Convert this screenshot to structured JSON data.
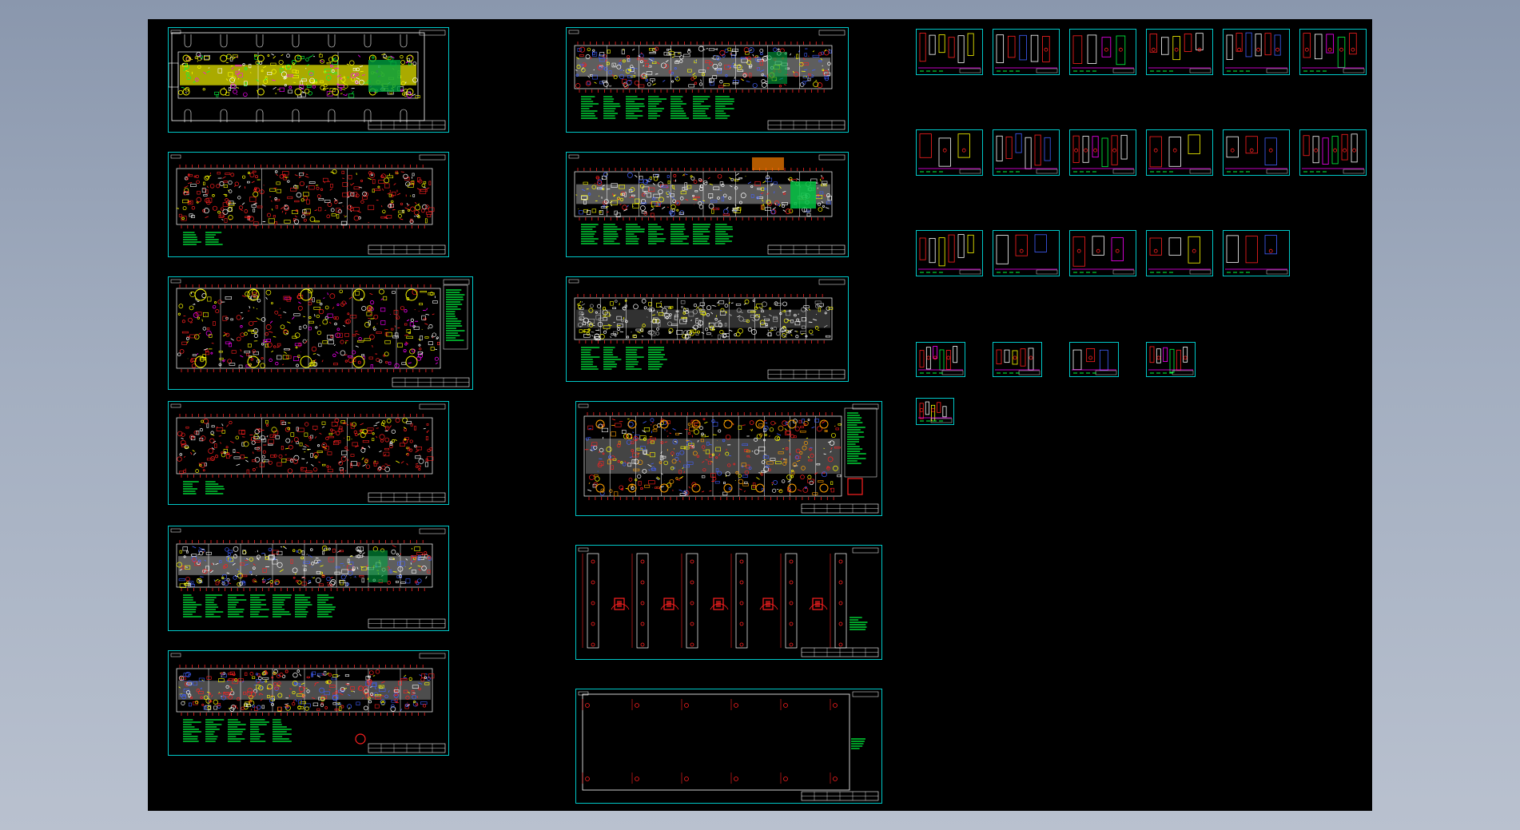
{
  "viewer": {
    "background_top": "#8a97ad",
    "background_bottom": "#b9c1cf",
    "canvas_color": "#000000"
  },
  "colors": {
    "frame": "#00c8c8",
    "red": "#ff2020",
    "yellow": "#ffff00",
    "green": "#00ff40",
    "white": "#ffffff",
    "gray": "#b0b0b0",
    "magenta": "#ff00ff",
    "orange": "#ffa000",
    "blue": "#4060ff"
  },
  "drawing_sheets": {
    "left_column": [
      {
        "id": "L1",
        "style": "yellow-green-layout"
      },
      {
        "id": "L2",
        "style": "red-plate"
      },
      {
        "id": "L3",
        "style": "red-plate-circles-notes"
      },
      {
        "id": "L4",
        "style": "red-plate"
      },
      {
        "id": "L5",
        "style": "gray-strip-notes"
      },
      {
        "id": "L6",
        "style": "red-gray-strip-notes"
      }
    ],
    "middle_column": [
      {
        "id": "M1",
        "style": "gray-strip-notes"
      },
      {
        "id": "M2",
        "style": "gray-strip-green-end"
      },
      {
        "id": "M3",
        "style": "white-strip-notes"
      },
      {
        "id": "M4",
        "style": "red-plate-mixed"
      },
      {
        "id": "M5",
        "style": "vertical-bars"
      },
      {
        "id": "M6",
        "style": "sparse-frame"
      }
    ],
    "part_thumbnails": {
      "row_1": 6,
      "row_2": 6,
      "row_3": 5,
      "row_4": 4,
      "row_5": 1
    }
  }
}
